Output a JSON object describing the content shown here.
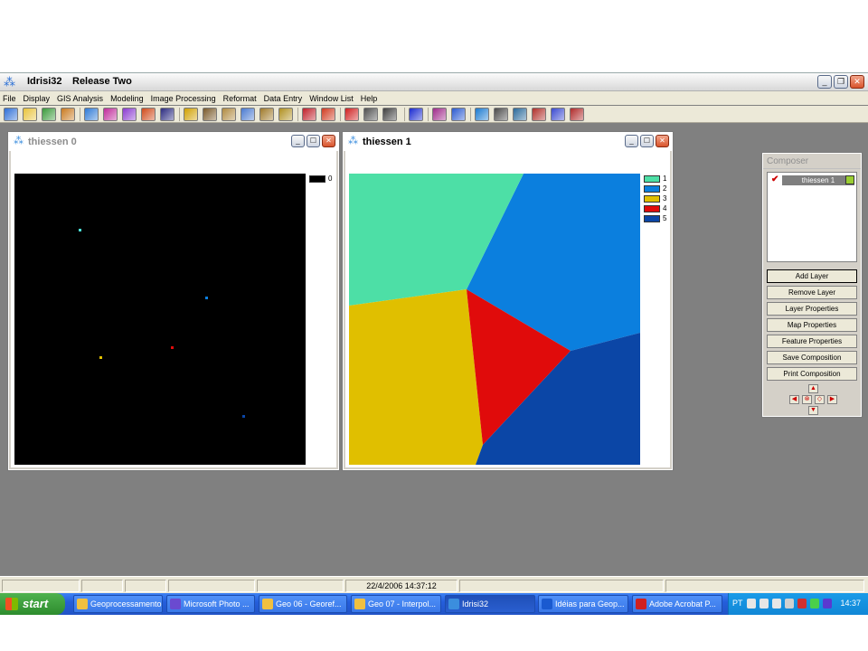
{
  "app": {
    "title": "Idrisi32",
    "release": "Release Two"
  },
  "menu": [
    "File",
    "Display",
    "GIS Analysis",
    "Modeling",
    "Image Processing",
    "Reformat",
    "Data Entry",
    "Window List",
    "Help"
  ],
  "toolbar_icons": [
    {
      "name": "display-launcher-icon",
      "color": "#2e6fd6"
    },
    {
      "name": "open-folder-icon",
      "color": "#e8c33a"
    },
    {
      "name": "composer-icon",
      "color": "#3a9a3a"
    },
    {
      "name": "palette-icon",
      "color": "#c97a20"
    },
    {
      "name": "map-icon",
      "color": "#2e7ad6"
    },
    {
      "name": "digitize-icon",
      "color": "#c02a9a"
    },
    {
      "name": "stretch-icon",
      "color": "#8a3ad0"
    },
    {
      "name": "swap-arrows-icon",
      "color": "#d04a1a"
    },
    {
      "name": "overlay-icon",
      "color": "#2a2a80"
    },
    {
      "name": "query-icon",
      "color": "#d0a000"
    },
    {
      "name": "histogram-icon",
      "color": "#7a5a2a"
    },
    {
      "name": "layer-icon",
      "color": "#b08a40"
    },
    {
      "name": "image-icon",
      "color": "#4a7ad0"
    },
    {
      "name": "link-icon",
      "color": "#a07a2a"
    },
    {
      "name": "group-icon",
      "color": "#b09020"
    },
    {
      "name": "help-query-icon",
      "color": "#c0202a"
    },
    {
      "name": "report-icon",
      "color": "#d03a20"
    },
    {
      "name": "target-icon",
      "color": "#d02020"
    },
    {
      "name": "cross-icon",
      "color": "#505050"
    },
    {
      "name": "pointer-icon",
      "color": "#404040"
    },
    {
      "name": "gps-icon",
      "color": "#1a2ad0"
    },
    {
      "name": "chart-icon",
      "color": "#a02a8a"
    },
    {
      "name": "waves-icon",
      "color": "#2a5ad0"
    },
    {
      "name": "export-icon",
      "color": "#1a7ad0"
    },
    {
      "name": "table-icon",
      "color": "#4a4a4a"
    },
    {
      "name": "spreadsheet-icon",
      "color": "#2a6a9a"
    },
    {
      "name": "flow-icon",
      "color": "#b0302a"
    },
    {
      "name": "bars-icon",
      "color": "#3a4ad0"
    },
    {
      "name": "eraser-icon",
      "color": "#b02a2a"
    }
  ],
  "window0": {
    "title": "thiessen 0",
    "legend_label": "0"
  },
  "window1": {
    "title": "thiessen 1",
    "legend": [
      {
        "label": "1",
        "color": "#4ddfa6"
      },
      {
        "label": "2",
        "color": "#0b7fde"
      },
      {
        "label": "3",
        "color": "#e0bf00"
      },
      {
        "label": "4",
        "color": "#e00b0b"
      },
      {
        "label": "5",
        "color": "#0b46a6"
      }
    ]
  },
  "window0_points": [
    {
      "color": "#4ddfd6"
    },
    {
      "color": "#0b7fde"
    },
    {
      "color": "#e0bf00"
    },
    {
      "color": "#e00b0b"
    },
    {
      "color": "#0b46a6"
    }
  ],
  "composer": {
    "title": "Composer",
    "layer_name": "thiessen 1",
    "buttons": [
      "Add Layer",
      "Remove Layer",
      "Layer Properties",
      "Map Properties",
      "Feature Properties",
      "Save Composition",
      "Print Composition"
    ]
  },
  "status": {
    "datetime": "22/4/2006 14:37:12"
  },
  "taskbar": {
    "start": "start",
    "tasks": [
      "Geoprocessamento",
      "Microsoft Photo ...",
      "Geo 06 - Georef...",
      "Geo 07 - Interpol...",
      "Idrisi32",
      "Idéias para Geop...",
      "Adobe Acrobat P..."
    ],
    "task_colors": [
      "#f0c040",
      "#6a4ad0",
      "#f0c040",
      "#f0c040",
      "#3b8ede",
      "#1a5ad0",
      "#d02020"
    ],
    "lang": "PT",
    "clock": "14:37"
  }
}
